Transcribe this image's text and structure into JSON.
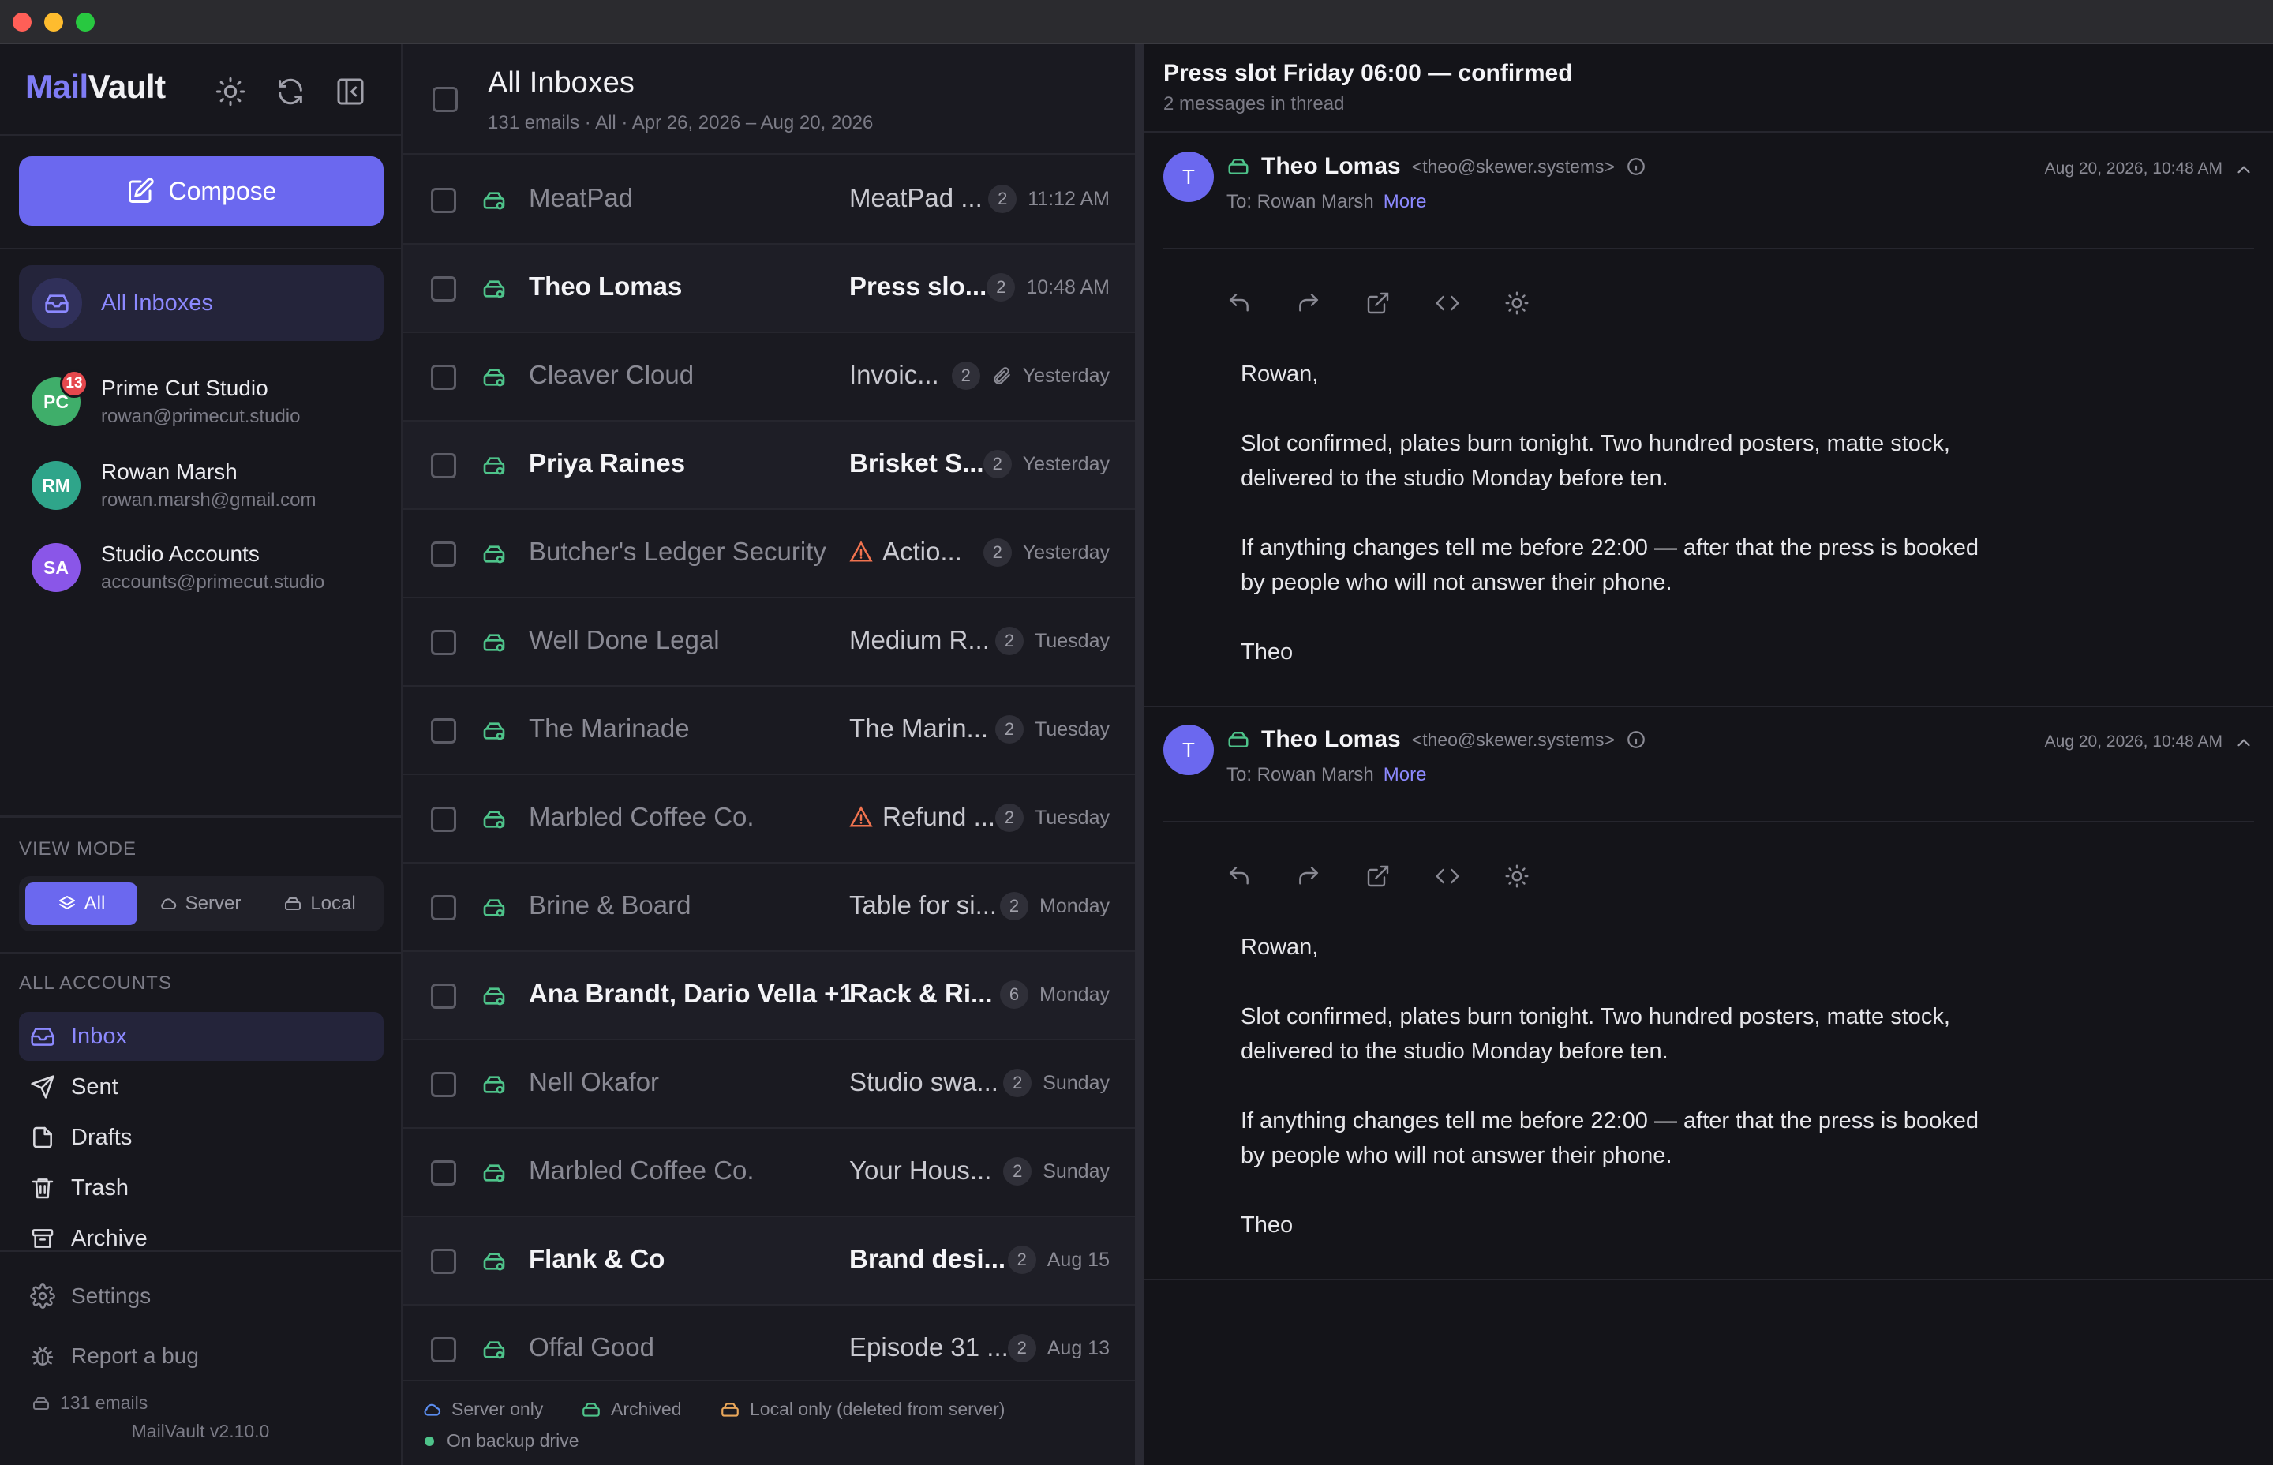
{
  "window": {
    "traffic": [
      "#ff5f57",
      "#febc2e",
      "#28c840"
    ]
  },
  "sidebar": {
    "logo": {
      "part1": "Mail",
      "part2": "Vault"
    },
    "icons": [
      "sun-icon",
      "refresh-icon",
      "collapse-sidebar-icon"
    ],
    "compose_label": "Compose",
    "all_inboxes_label": "All Inboxes",
    "accounts": [
      {
        "initials": "PC",
        "name": "Prime Cut Studio",
        "email": "rowan@primecut.studio",
        "color": "#3fae6a",
        "badge": "13"
      },
      {
        "initials": "RM",
        "name": "Rowan Marsh",
        "email": "rowan.marsh@gmail.com",
        "color": "#2fa58a",
        "badge": ""
      },
      {
        "initials": "SA",
        "name": "Studio Accounts",
        "email": "accounts@primecut.studio",
        "color": "#8a56e8",
        "badge": ""
      }
    ],
    "view_mode": {
      "label": "VIEW MODE",
      "options": [
        {
          "label": "All",
          "icon": "layers-icon",
          "active": true
        },
        {
          "label": "Server",
          "icon": "cloud-icon",
          "active": false
        },
        {
          "label": "Local",
          "icon": "drive-icon",
          "active": false
        }
      ]
    },
    "all_accounts_label": "ALL ACCOUNTS",
    "folders": [
      {
        "label": "Inbox",
        "icon": "inbox-icon",
        "active": true
      },
      {
        "label": "Sent",
        "icon": "send-icon",
        "active": false
      },
      {
        "label": "Drafts",
        "icon": "file-icon",
        "active": false
      },
      {
        "label": "Trash",
        "icon": "trash-icon",
        "active": false
      },
      {
        "label": "Archive",
        "icon": "archive-icon",
        "active": false
      }
    ],
    "settings_label": "Settings",
    "report_label": "Report a bug",
    "email_count": "131 emails",
    "version": "MailVault v2.10.0"
  },
  "list": {
    "title": "All Inboxes",
    "subtitle": "131 emails · All · Apr 26, 2026 – Aug 20, 2026",
    "rows": [
      {
        "sender": "MeatPad",
        "subject": "MeatPad ...",
        "count": "2",
        "time": "11:12 AM",
        "unread": false,
        "flag": "",
        "attach": false
      },
      {
        "sender": "Theo Lomas",
        "subject": "Press slo...",
        "count": "2",
        "time": "10:48 AM",
        "unread": true,
        "flag": "",
        "attach": false
      },
      {
        "sender": "Cleaver Cloud",
        "subject": "Invoic...",
        "count": "2",
        "time": "Yesterday",
        "unread": false,
        "flag": "",
        "attach": true
      },
      {
        "sender": "Priya Raines",
        "subject": "Brisket S...",
        "count": "2",
        "time": "Yesterday",
        "unread": true,
        "flag": "",
        "attach": false
      },
      {
        "sender": "Butcher's Ledger Security",
        "subject": "Actio...",
        "count": "2",
        "time": "Yesterday",
        "unread": false,
        "flag": "warning",
        "attach": false
      },
      {
        "sender": "Well Done Legal",
        "subject": "Medium R...",
        "count": "2",
        "time": "Tuesday",
        "unread": false,
        "flag": "",
        "attach": false
      },
      {
        "sender": "The Marinade",
        "subject": "The Marin...",
        "count": "2",
        "time": "Tuesday",
        "unread": false,
        "flag": "",
        "attach": false
      },
      {
        "sender": "Marbled Coffee Co.",
        "subject": "Refund ...",
        "count": "2",
        "time": "Tuesday",
        "unread": false,
        "flag": "warning",
        "attach": false
      },
      {
        "sender": "Brine & Board",
        "subject": "Table for si...",
        "count": "2",
        "time": "Monday",
        "unread": false,
        "flag": "",
        "attach": false
      },
      {
        "sender": "Ana Brandt, Dario Vella +1",
        "subject": "Rack & Ri...",
        "count": "6",
        "time": "Monday",
        "unread": true,
        "flag": "",
        "attach": false
      },
      {
        "sender": "Nell Okafor",
        "subject": "Studio swa...",
        "count": "2",
        "time": "Sunday",
        "unread": false,
        "flag": "",
        "attach": false
      },
      {
        "sender": "Marbled Coffee Co.",
        "subject": "Your Hous...",
        "count": "2",
        "time": "Sunday",
        "unread": false,
        "flag": "",
        "attach": false
      },
      {
        "sender": "Flank & Co",
        "subject": "Brand desi...",
        "count": "2",
        "time": "Aug 15",
        "unread": true,
        "flag": "",
        "attach": false
      },
      {
        "sender": "Offal Good",
        "subject": "Episode 31 ...",
        "count": "2",
        "time": "Aug 13",
        "unread": false,
        "flag": "",
        "attach": false
      }
    ],
    "legend": {
      "server": "Server only",
      "archived": "Archived",
      "local": "Local only (deleted from server)",
      "backup": "On backup drive"
    }
  },
  "reader": {
    "title": "Press slot Friday 06:00 — confirmed",
    "subtitle": "2 messages in thread",
    "messages": [
      {
        "initial": "T",
        "name": "Theo Lomas",
        "address": "<theo@skewer.systems>",
        "to": "To: Rowan Marsh",
        "more": "More",
        "date": "Aug 20, 2026, 10:48 AM",
        "body": [
          "Rowan,",
          "Slot confirmed, plates burn tonight. Two hundred posters, matte stock, delivered to the studio Monday before ten.",
          "If anything changes tell me before 22:00 — after that the press is booked by people who will not answer their phone.",
          "Theo"
        ]
      },
      {
        "initial": "T",
        "name": "Theo Lomas",
        "address": "<theo@skewer.systems>",
        "to": "To: Rowan Marsh",
        "more": "More",
        "date": "Aug 20, 2026, 10:48 AM",
        "body": [
          "Rowan,",
          "Slot confirmed, plates burn tonight. Two hundred posters, matte stock, delivered to the studio Monday before ten.",
          "If anything changes tell me before 22:00 — after that the press is booked by people who will not answer their phone.",
          "Theo"
        ]
      }
    ]
  }
}
